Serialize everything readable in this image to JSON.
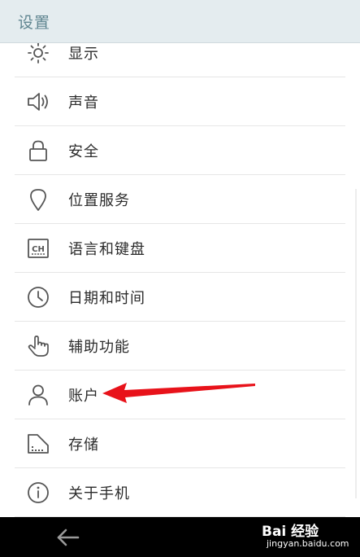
{
  "header": {
    "title": "设置"
  },
  "settings": {
    "items": [
      {
        "label": "显示",
        "icon": "brightness-icon"
      },
      {
        "label": "声音",
        "icon": "speaker-icon"
      },
      {
        "label": "安全",
        "icon": "lock-icon"
      },
      {
        "label": "位置服务",
        "icon": "location-pin-icon"
      },
      {
        "label": "语言和键盘",
        "icon": "language-icon"
      },
      {
        "label": "日期和时间",
        "icon": "clock-icon"
      },
      {
        "label": "辅助功能",
        "icon": "hand-pointer-icon"
      },
      {
        "label": "账户",
        "icon": "person-icon"
      },
      {
        "label": "存储",
        "icon": "storage-icon"
      },
      {
        "label": "关于手机",
        "icon": "info-icon"
      }
    ],
    "language_icon_text": "CH"
  },
  "navigation": {
    "back_icon": "back-arrow-icon"
  },
  "watermark": {
    "main": "Bai 经验",
    "sub": "jingyan.baidu.com"
  },
  "colors": {
    "header_bg": "#e4ecef",
    "header_text": "#5f8590",
    "item_text": "#2b2b2b",
    "icon_stroke": "#555555",
    "divider": "#e6e6e6",
    "nav_bg": "#000000",
    "annotation_arrow": "#e8121a"
  }
}
